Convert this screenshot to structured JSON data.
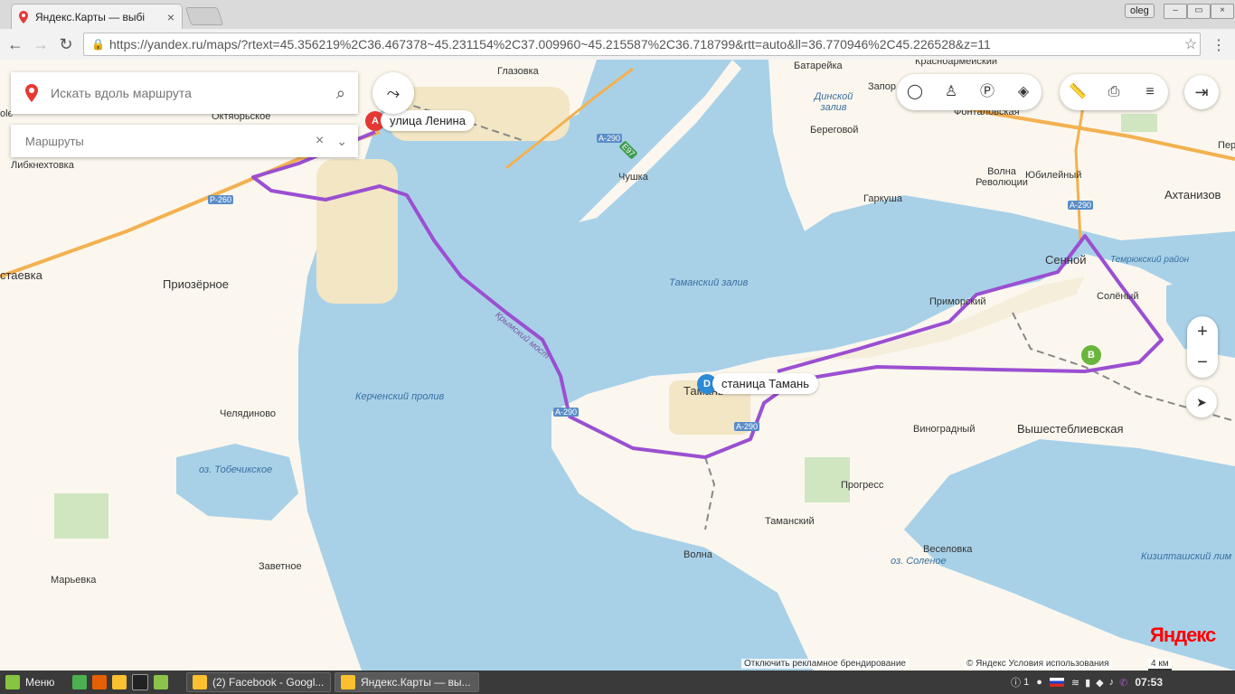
{
  "browser": {
    "tab_title": "Яндекс.Карты — выбі",
    "profile_name": "oleg",
    "url": "https://yandex.ru/maps/?rtext=45.356219%2C36.467378~45.231154%2C37.009960~45.215587%2C36.718799&rtt=auto&ll=36.770946%2C45.226528&z=11"
  },
  "panel": {
    "search_placeholder": "Искать вдоль маршрута",
    "routes_label": "Маршруты"
  },
  "markers": {
    "a": {
      "letter": "A",
      "label": "улица Ленина",
      "color": "#e53935"
    },
    "b": {
      "letter": "B",
      "label": "",
      "color": "#6ab53d"
    },
    "d": {
      "letter": "D",
      "label": "станица Тамань",
      "color": "#2d8bd6"
    }
  },
  "places": {
    "glazovka": "Глазовка",
    "batareyka": "Батарейка",
    "krasnoarmeyskiy": "Красноармейский",
    "zapor": "Запор",
    "oktyabrskoe": "Октябрьское",
    "lole": "ole",
    "libknekhtovka": "Либкнехтовка",
    "staevka": "стаевка",
    "priozernoe": "Приозёрное",
    "chushka": "Чушка",
    "dinskoy": "Динской залив",
    "beregovoy": "Береговой",
    "fontalovskaya": "Фонталовская",
    "volna_revolyutsii": "Волна Революции",
    "yubileyny": "Юбилейный",
    "garkusha": "Гаркуша",
    "akhtanizov": "Ахтанизов",
    "senoy": "Сенной",
    "temryuk_rayon": "Темрюкский район",
    "primorskiy": "Приморский",
    "solenyy": "Солёный",
    "tamanskiy_zaliv": "Таманский залив",
    "kerch_strait": "Керченский пролив",
    "chelyadinovo": "Челядиново",
    "tobechik": "оз. Тобечикское",
    "taman": "Тамань",
    "vinogradny": "Виноградный",
    "vyshesteblievskaya": "Вышестеблиевская",
    "progress": "Прогресс",
    "tamanskiy": "Таманский",
    "zavetnoe": "Заветное",
    "maryevka": "Марьевка",
    "volna": "Волна",
    "veselovka": "Веселовка",
    "ozero_solenoe": "оз. Соленое",
    "kizil": "Кизилташский лим",
    "per": "Пер",
    "crimean_bridge": "Крымский мост"
  },
  "roads": {
    "a290_1": "А-290",
    "a290_2": "А-290",
    "a290_3": "А-290",
    "a290_4": "А-290",
    "r260": "Р-260",
    "e97": "E97"
  },
  "footer": {
    "ad_text": "Отключить рекламное брендирование",
    "copyright": "© Яндекс Условия использования",
    "scale": "4 км"
  },
  "logo": "Яндекс",
  "taskbar": {
    "menu": "Меню",
    "win1": "(2) Facebook - Googl...",
    "win2": "Яндекс.Карты — вы...",
    "notif_count": "1",
    "time": "07:53"
  },
  "colors": {
    "route": "#9b4fd1",
    "water": "#a8d1e8",
    "land": "#fbf7ee"
  }
}
